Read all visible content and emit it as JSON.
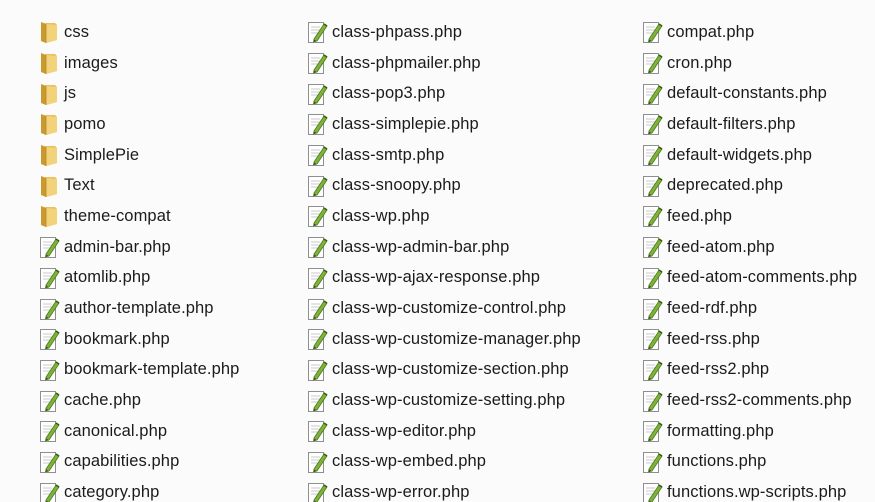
{
  "columns": [
    [
      {
        "name": "css",
        "type": "folder"
      },
      {
        "name": "images",
        "type": "folder"
      },
      {
        "name": "js",
        "type": "folder"
      },
      {
        "name": "pomo",
        "type": "folder"
      },
      {
        "name": "SimplePie",
        "type": "folder"
      },
      {
        "name": "Text",
        "type": "folder"
      },
      {
        "name": "theme-compat",
        "type": "folder"
      },
      {
        "name": "admin-bar.php",
        "type": "php"
      },
      {
        "name": "atomlib.php",
        "type": "php"
      },
      {
        "name": "author-template.php",
        "type": "php"
      },
      {
        "name": "bookmark.php",
        "type": "php"
      },
      {
        "name": "bookmark-template.php",
        "type": "php"
      },
      {
        "name": "cache.php",
        "type": "php"
      },
      {
        "name": "canonical.php",
        "type": "php"
      },
      {
        "name": "capabilities.php",
        "type": "php"
      },
      {
        "name": "category.php",
        "type": "php"
      }
    ],
    [
      {
        "name": "class-phpass.php",
        "type": "php"
      },
      {
        "name": "class-phpmailer.php",
        "type": "php"
      },
      {
        "name": "class-pop3.php",
        "type": "php"
      },
      {
        "name": "class-simplepie.php",
        "type": "php"
      },
      {
        "name": "class-smtp.php",
        "type": "php"
      },
      {
        "name": "class-snoopy.php",
        "type": "php"
      },
      {
        "name": "class-wp.php",
        "type": "php"
      },
      {
        "name": "class-wp-admin-bar.php",
        "type": "php"
      },
      {
        "name": "class-wp-ajax-response.php",
        "type": "php"
      },
      {
        "name": "class-wp-customize-control.php",
        "type": "php"
      },
      {
        "name": "class-wp-customize-manager.php",
        "type": "php"
      },
      {
        "name": "class-wp-customize-section.php",
        "type": "php"
      },
      {
        "name": "class-wp-customize-setting.php",
        "type": "php"
      },
      {
        "name": "class-wp-editor.php",
        "type": "php"
      },
      {
        "name": "class-wp-embed.php",
        "type": "php"
      },
      {
        "name": "class-wp-error.php",
        "type": "php"
      }
    ],
    [
      {
        "name": "compat.php",
        "type": "php"
      },
      {
        "name": "cron.php",
        "type": "php"
      },
      {
        "name": "default-constants.php",
        "type": "php"
      },
      {
        "name": "default-filters.php",
        "type": "php"
      },
      {
        "name": "default-widgets.php",
        "type": "php"
      },
      {
        "name": "deprecated.php",
        "type": "php"
      },
      {
        "name": "feed.php",
        "type": "php"
      },
      {
        "name": "feed-atom.php",
        "type": "php"
      },
      {
        "name": "feed-atom-comments.php",
        "type": "php"
      },
      {
        "name": "feed-rdf.php",
        "type": "php"
      },
      {
        "name": "feed-rss.php",
        "type": "php"
      },
      {
        "name": "feed-rss2.php",
        "type": "php"
      },
      {
        "name": "feed-rss2-comments.php",
        "type": "php"
      },
      {
        "name": "formatting.php",
        "type": "php"
      },
      {
        "name": "functions.php",
        "type": "php"
      },
      {
        "name": "functions.wp-scripts.php",
        "type": "php"
      }
    ]
  ],
  "icons": {
    "folder": "folder-icon",
    "php": "php-file-icon"
  },
  "colors": {
    "folder_body": "#e8c05a",
    "folder_dark": "#c99a2e",
    "file_page": "#ffffff",
    "file_border": "#9a9a9a",
    "pencil": "#7db33b"
  }
}
